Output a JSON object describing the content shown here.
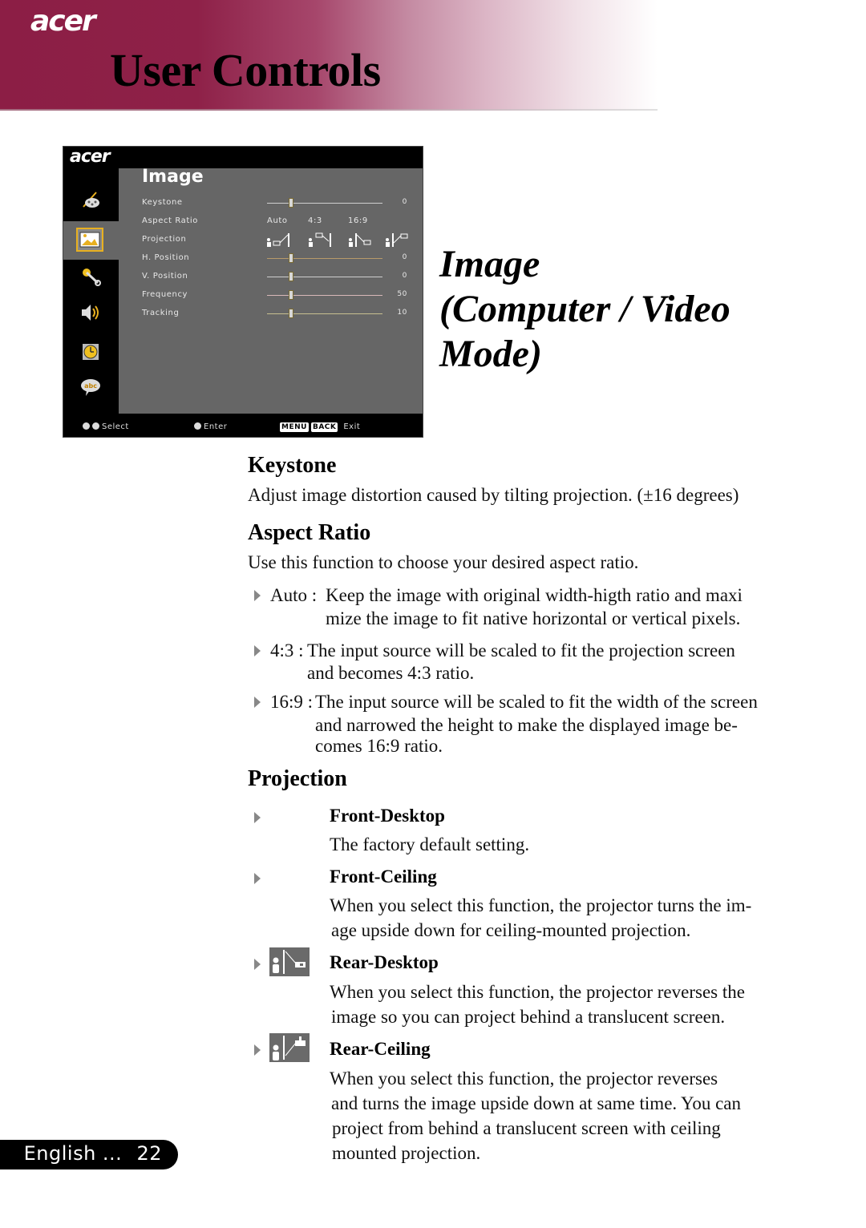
{
  "header": {
    "brand": "acer",
    "title": "User Controls",
    "gradient_colors": [
      "#8c1e45",
      "#ffffff"
    ]
  },
  "osd": {
    "brand": "acer",
    "menu_title": "Image",
    "sidebar_icons": [
      "color-palette-icon",
      "image-icon",
      "settings-wrench-icon",
      "speaker-icon",
      "timer-clock-icon",
      "language-abc-icon"
    ],
    "active_sidebar_index": 1,
    "accent_color": "#e8b020",
    "rows": [
      {
        "label": "Keystone",
        "type": "slider",
        "value": "0"
      },
      {
        "label": "Aspect Ratio",
        "type": "options",
        "options": [
          "Auto",
          "4:3",
          "16:9"
        ]
      },
      {
        "label": "Projection",
        "type": "icons",
        "icons": [
          "front-desktop-icon",
          "front-ceiling-icon",
          "rear-desktop-icon",
          "rear-ceiling-icon"
        ]
      },
      {
        "label": "H. Position",
        "type": "slider",
        "value": "0"
      },
      {
        "label": "V. Position",
        "type": "slider",
        "value": "0"
      },
      {
        "label": "Frequency",
        "type": "slider",
        "value": "50"
      },
      {
        "label": "Tracking",
        "type": "slider",
        "value": "10"
      }
    ],
    "footer": {
      "select": "Select",
      "enter": "Enter",
      "menu_key": "MENU",
      "back_key": "BACK",
      "exit": "Exit"
    }
  },
  "section_title": {
    "line1": "Image",
    "line2": "(Computer / Video",
    "line3": "Mode)"
  },
  "keystone": {
    "heading": "Keystone",
    "text": "Adjust image distortion caused by tilting projection. (±16 degrees)"
  },
  "aspect_ratio": {
    "heading": "Aspect Ratio",
    "intro": "Use this function to choose your desired aspect ratio.",
    "items": [
      {
        "label": "Auto :",
        "line1": "Keep the image with original width-higth ratio and maxi",
        "line2": "mize the image to fit native horizontal or vertical pixels."
      },
      {
        "label": "4:3 :",
        "line1": "The input source will be scaled to fit the projection screen",
        "line2": "and becomes 4:3 ratio."
      },
      {
        "label": "16:9 :",
        "line1": "The input source will be scaled to fit the width of the screen",
        "line2": "and narrowed the height to make the displayed image be-",
        "line3": "comes 16:9 ratio."
      }
    ]
  },
  "projection": {
    "heading": "Projection",
    "items": [
      {
        "title": "Front-Desktop",
        "lines": [
          "The factory default setting."
        ]
      },
      {
        "title": "Front-Ceiling",
        "lines": [
          "When you select this function, the projector turns the im-",
          "age upside down for ceiling-mounted projection."
        ]
      },
      {
        "title": "Rear-Desktop",
        "icon": "rear-desktop-icon",
        "lines": [
          "When you select this function, the projector reverses the",
          "image  so you can project behind a translucent screen."
        ]
      },
      {
        "title": "Rear-Ceiling",
        "icon": "rear-ceiling-icon",
        "lines": [
          "When you select this function, the projector reverses",
          "and turns the image upside down at same time. You can",
          "project from behind a translucent screen with ceiling",
          "mounted projection."
        ]
      }
    ]
  },
  "footer": {
    "language": "English ...",
    "page": "22"
  }
}
